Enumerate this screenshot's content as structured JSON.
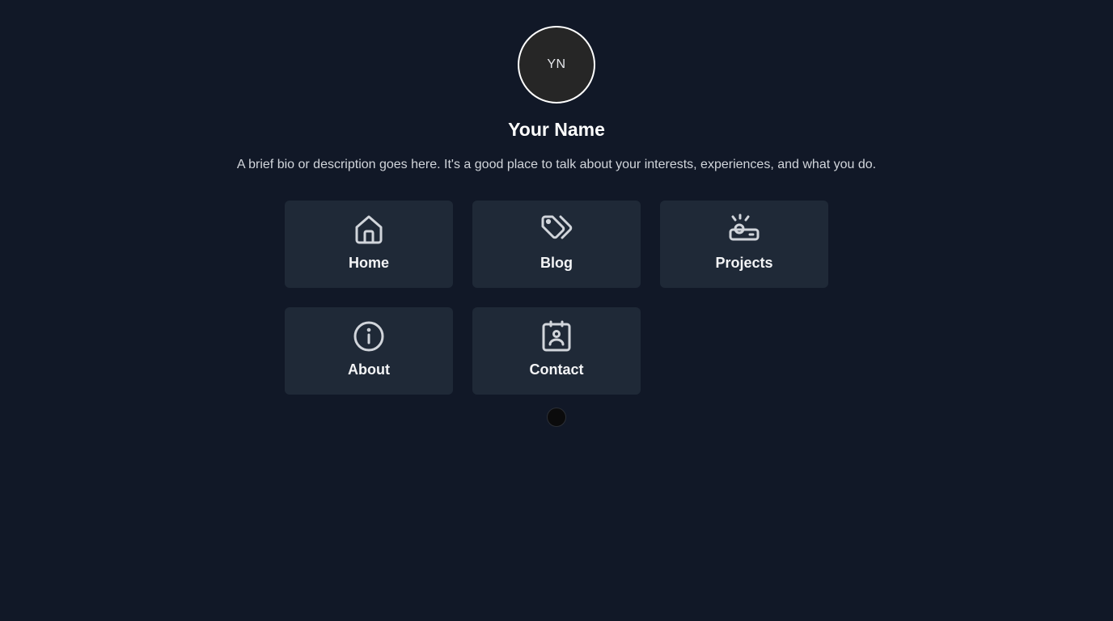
{
  "profile": {
    "avatar_initials": "YN",
    "name": "Your Name",
    "bio": "A brief bio or description goes here. It's a good place to talk about your interests, experiences, and what you do."
  },
  "nav": {
    "cards": [
      {
        "label": "Home",
        "icon": "home-icon"
      },
      {
        "label": "Blog",
        "icon": "tags-icon"
      },
      {
        "label": "Projects",
        "icon": "projector-icon"
      },
      {
        "label": "About",
        "icon": "info-circle-icon"
      },
      {
        "label": "Contact",
        "icon": "contact-badge-icon"
      }
    ]
  },
  "colors": {
    "background": "#111827",
    "card": "#1f2937",
    "icon_stroke": "#d1d5db",
    "text": "#ffffff",
    "muted_text": "#d1d5db"
  }
}
